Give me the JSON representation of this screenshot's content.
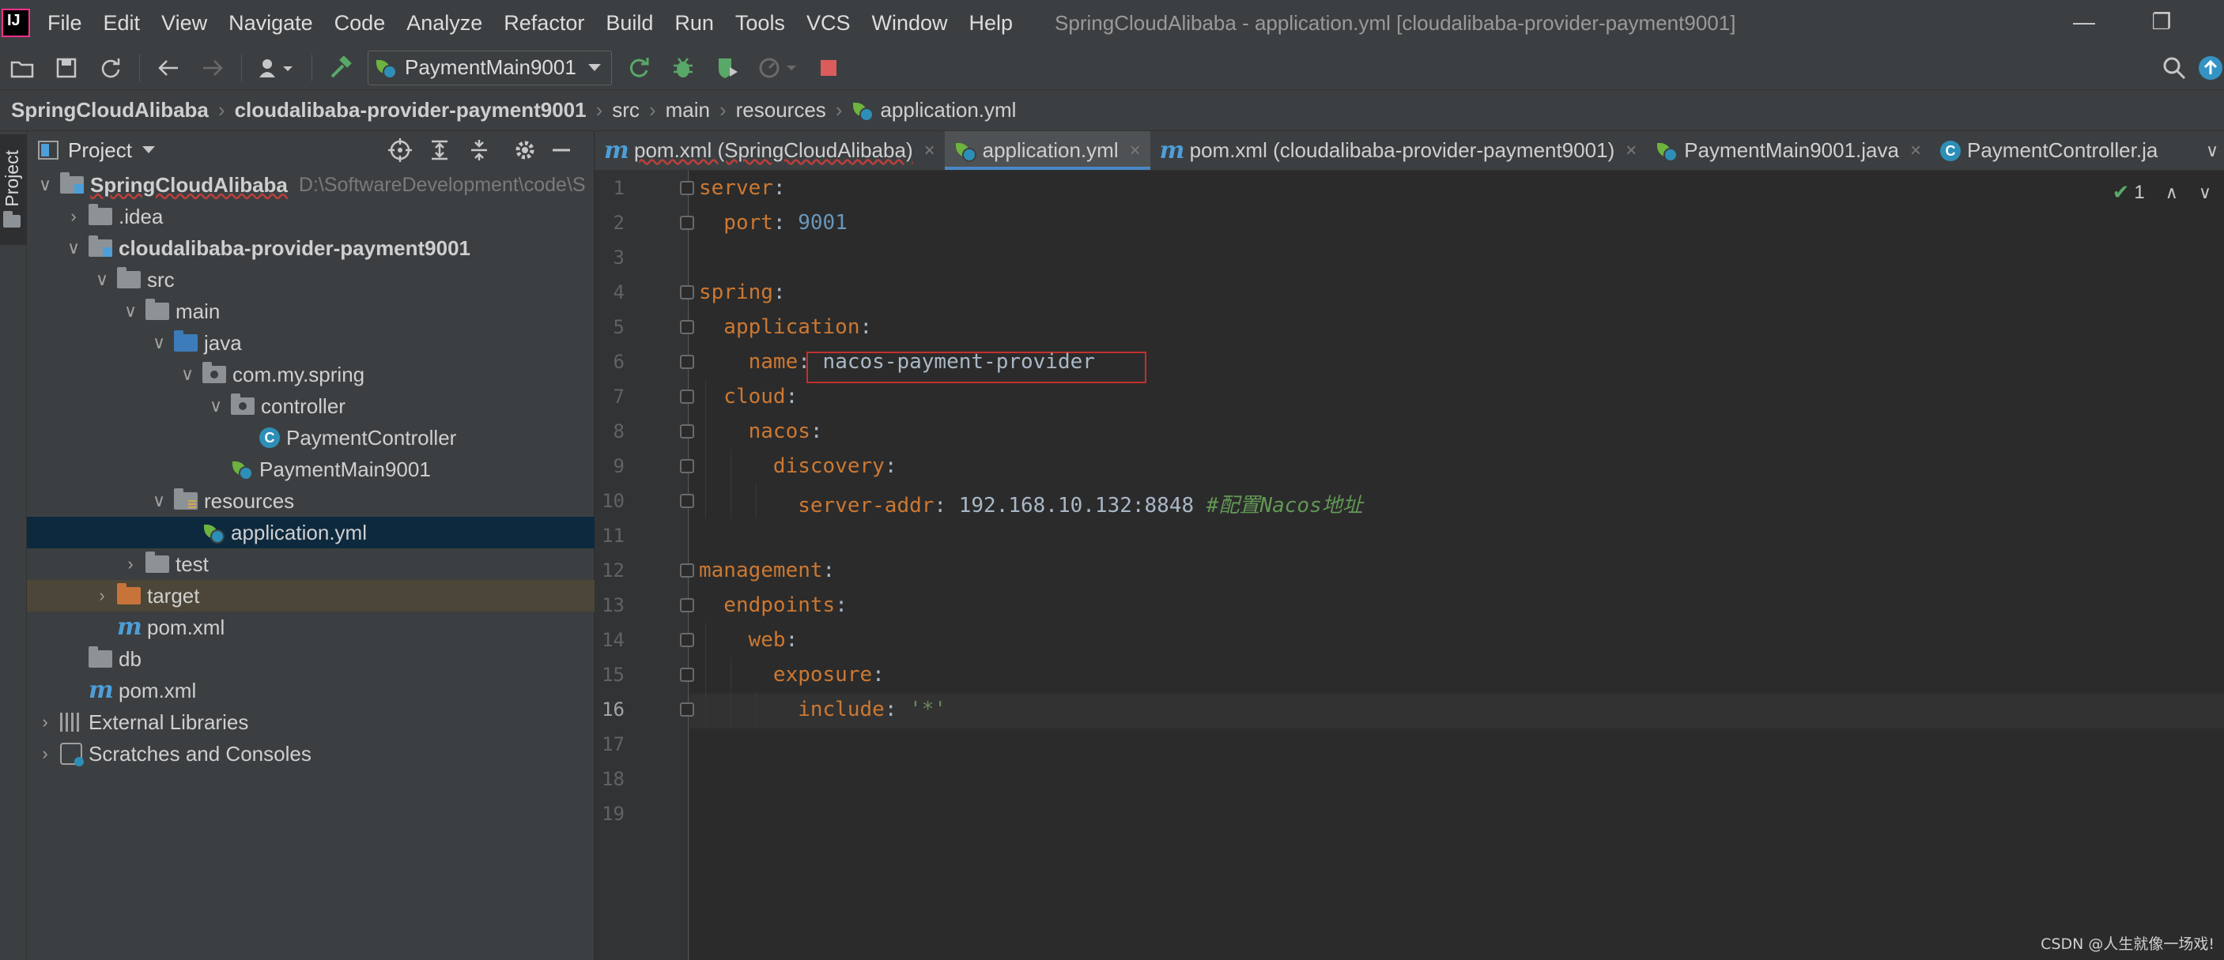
{
  "menubar": {
    "logo_text": "IJ",
    "items": [
      "File",
      "Edit",
      "View",
      "Navigate",
      "Code",
      "Analyze",
      "Refactor",
      "Build",
      "Run",
      "Tools",
      "VCS",
      "Window",
      "Help"
    ],
    "window_title": "SpringCloudAlibaba - application.yml [cloudalibaba-provider-payment9001]"
  },
  "toolbar": {
    "run_config": "PaymentMain9001"
  },
  "breadcrumbs": [
    "SpringCloudAlibaba",
    "cloudalibaba-provider-payment9001",
    "src",
    "main",
    "resources",
    "application.yml"
  ],
  "left_stripe": {
    "label": "Project"
  },
  "project_panel": {
    "title": "Project",
    "tree": [
      {
        "label": "SpringCloudAlibaba",
        "hint": "D:\\SoftwareDevelopment\\code\\S",
        "icon": "module-folder-icon",
        "expanded": true,
        "depth": 0
      },
      {
        "label": ".idea",
        "icon": "folder-icon",
        "expanded": false,
        "depth": 1
      },
      {
        "label": "cloudalibaba-provider-payment9001",
        "icon": "module-folder-icon",
        "expanded": true,
        "depth": 1
      },
      {
        "label": "src",
        "icon": "folder-icon",
        "expanded": true,
        "depth": 2
      },
      {
        "label": "main",
        "icon": "folder-icon",
        "expanded": true,
        "depth": 3
      },
      {
        "label": "java",
        "icon": "source-folder-icon",
        "expanded": true,
        "depth": 4
      },
      {
        "label": "com.my.spring",
        "icon": "package-icon",
        "expanded": true,
        "depth": 5
      },
      {
        "label": "controller",
        "icon": "package-icon",
        "expanded": true,
        "depth": 6
      },
      {
        "label": "PaymentController",
        "icon": "java-class-icon",
        "depth": 7
      },
      {
        "label": "PaymentMain9001",
        "icon": "spring-boot-class-icon",
        "depth": 6
      },
      {
        "label": "resources",
        "icon": "resources-folder-icon",
        "expanded": true,
        "depth": 4
      },
      {
        "label": "application.yml",
        "icon": "spring-yaml-icon",
        "depth": 5,
        "selected": true
      },
      {
        "label": "test",
        "icon": "folder-icon",
        "expanded": false,
        "depth": 3
      },
      {
        "label": "target",
        "icon": "excluded-folder-icon",
        "expanded": false,
        "depth": 2,
        "excluded": true
      },
      {
        "label": "pom.xml",
        "icon": "maven-icon",
        "depth": 2
      },
      {
        "label": "db",
        "icon": "folder-icon",
        "depth": 1
      },
      {
        "label": "pom.xml",
        "icon": "maven-icon",
        "depth": 1
      },
      {
        "label": "External Libraries",
        "icon": "libraries-icon",
        "expanded": false,
        "depth": 0
      },
      {
        "label": "Scratches and Consoles",
        "icon": "scratches-icon",
        "expanded": false,
        "depth": 0
      }
    ]
  },
  "tabs": [
    {
      "label": "pom.xml (SpringCloudAlibaba)",
      "icon": "maven-icon",
      "active": false
    },
    {
      "label": "application.yml",
      "icon": "spring-yaml-icon",
      "active": true
    },
    {
      "label": "pom.xml (cloudalibaba-provider-payment9001)",
      "icon": "maven-icon",
      "active": false
    },
    {
      "label": "PaymentMain9001.java",
      "icon": "spring-boot-class-icon",
      "active": false
    },
    {
      "label": "PaymentController.ja",
      "icon": "java-class-icon",
      "active": false
    }
  ],
  "editor": {
    "inspection_count": "1",
    "current_line": 16,
    "line_numbers": [
      "1",
      "2",
      "3",
      "4",
      "5",
      "6",
      "7",
      "8",
      "9",
      "10",
      "11",
      "12",
      "13",
      "14",
      "15",
      "16",
      "17",
      "18",
      "19"
    ],
    "lines": [
      [
        {
          "t": "server",
          "c": "k"
        },
        {
          "t": ":",
          "c": "v"
        }
      ],
      [
        {
          "t": "  port",
          "c": "k"
        },
        {
          "t": ": ",
          "c": "v"
        },
        {
          "t": "9001",
          "c": "num"
        }
      ],
      [],
      [
        {
          "t": "spring",
          "c": "k"
        },
        {
          "t": ":",
          "c": "v"
        }
      ],
      [
        {
          "t": "  application",
          "c": "k"
        },
        {
          "t": ":",
          "c": "v"
        }
      ],
      [
        {
          "t": "    name",
          "c": "k"
        },
        {
          "t": ": nacos-payment-provider",
          "c": "v"
        }
      ],
      [
        {
          "t": "  cloud",
          "c": "k"
        },
        {
          "t": ":",
          "c": "v"
        }
      ],
      [
        {
          "t": "    nacos",
          "c": "k"
        },
        {
          "t": ":",
          "c": "v"
        }
      ],
      [
        {
          "t": "      discovery",
          "c": "k"
        },
        {
          "t": ":",
          "c": "v"
        }
      ],
      [
        {
          "t": "        server-addr",
          "c": "k"
        },
        {
          "t": ": 192.168.10.132:8848 ",
          "c": "v"
        },
        {
          "t": "#配置Nacos地址",
          "c": "cmt"
        }
      ],
      [],
      [
        {
          "t": "management",
          "c": "k"
        },
        {
          "t": ":",
          "c": "v"
        }
      ],
      [
        {
          "t": "  endpoints",
          "c": "k"
        },
        {
          "t": ":",
          "c": "v"
        }
      ],
      [
        {
          "t": "    web",
          "c": "k"
        },
        {
          "t": ":",
          "c": "v"
        }
      ],
      [
        {
          "t": "      exposure",
          "c": "k"
        },
        {
          "t": ":",
          "c": "v"
        }
      ],
      [
        {
          "t": "        include",
          "c": "k"
        },
        {
          "t": ": ",
          "c": "v"
        },
        {
          "t": "'*'",
          "c": "str"
        }
      ],
      [],
      [],
      []
    ]
  },
  "watermark": "CSDN @人生就像一场戏!"
}
